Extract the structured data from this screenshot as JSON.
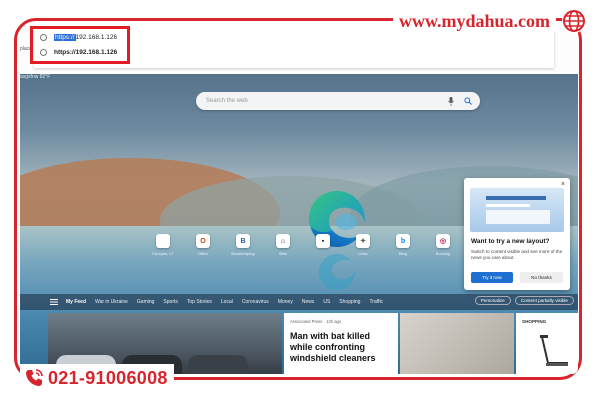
{
  "watermark": {
    "site": "www.mydahua.com",
    "phone": "021-91006008",
    "brand_color": "#d8242c"
  },
  "browser": {
    "address_dropdown": {
      "typed_selected": "https://",
      "typed_rest": "192.168.1.126",
      "suggestion": "https://192.168.1.126"
    },
    "left_tab_text": "place",
    "tab_line_text": "asgsfnw",
    "weather_text": "82°F"
  },
  "newtab": {
    "search_placeholder": "Search the web",
    "quick_links": [
      {
        "label": "Conquer, LT",
        "glyph": "",
        "color": "#7b5fc9"
      },
      {
        "label": "Office",
        "glyph": "O",
        "color": "#d83b01"
      },
      {
        "label": "Bookkeeping",
        "glyph": "B",
        "color": "#1e5ab3"
      },
      {
        "label": "Wes",
        "glyph": "⌂",
        "color": "#2b2b2b"
      },
      {
        "label": "",
        "glyph": "▪",
        "color": "#111111"
      },
      {
        "label": "Links",
        "glyph": "✦",
        "color": "#555555"
      },
      {
        "label": "Bing",
        "glyph": "b",
        "color": "#0a7cff"
      },
      {
        "label": "Booking",
        "glyph": "◎",
        "color": "#c2185b"
      }
    ]
  },
  "popup": {
    "title": "Want to try a new layout?",
    "description": "Switch to content visible and see more of the news you care about.",
    "try_label": "Try it now",
    "no_label": "No thanks",
    "close_glyph": "×"
  },
  "feed": {
    "items": [
      "My Feed",
      "War in Ukraine",
      "Gaming",
      "Sports",
      "Top Stories",
      "Local",
      "Coronavirus",
      "Money",
      "News",
      "US",
      "Shopping",
      "Traffic"
    ],
    "personalize_label": "Personalize",
    "content_label": "Content partially visible"
  },
  "news": {
    "card2_source": "Associated Press · 13h ago",
    "card2_headline": "Man with bat killed while confronting windshield cleaners",
    "card4_label": "SHOPPING"
  }
}
